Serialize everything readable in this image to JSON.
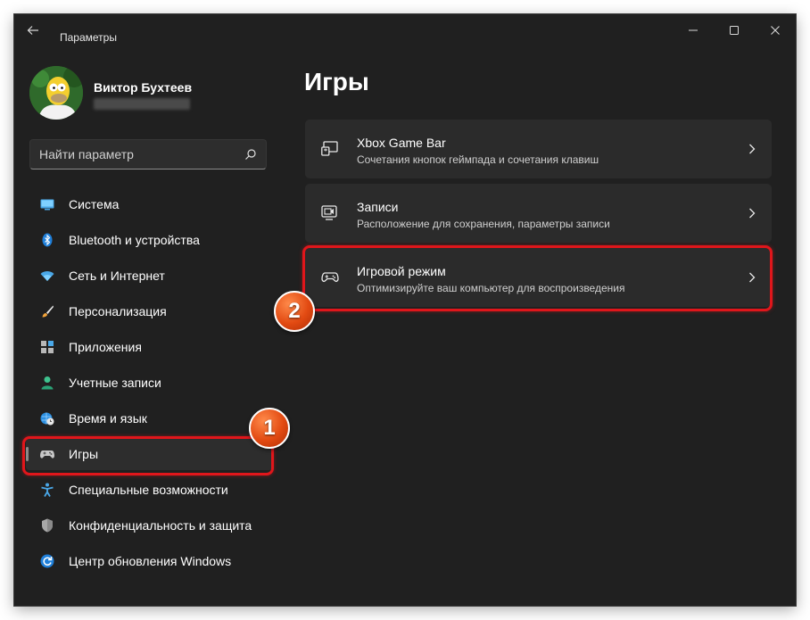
{
  "window": {
    "title": "Параметры",
    "controls": {
      "minimize": "minimize-icon",
      "maximize": "maximize-icon",
      "close": "close-icon"
    }
  },
  "user": {
    "name": "Виктор Бухтеев"
  },
  "search": {
    "placeholder": "Найти параметр",
    "value": ""
  },
  "sidebar": {
    "items": [
      {
        "label": "Система",
        "icon": "monitor-icon",
        "active": false
      },
      {
        "label": "Bluetooth и устройства",
        "icon": "bluetooth-icon",
        "active": false
      },
      {
        "label": "Сеть и Интернет",
        "icon": "wifi-icon",
        "active": false
      },
      {
        "label": "Персонализация",
        "icon": "brush-icon",
        "active": false
      },
      {
        "label": "Приложения",
        "icon": "apps-icon",
        "active": false
      },
      {
        "label": "Учетные записи",
        "icon": "person-icon",
        "active": false
      },
      {
        "label": "Время и язык",
        "icon": "globe-clock-icon",
        "active": false
      },
      {
        "label": "Игры",
        "icon": "gamepad-icon",
        "active": true
      },
      {
        "label": "Специальные возможности",
        "icon": "accessibility-icon",
        "active": false
      },
      {
        "label": "Конфиденциальность и защита",
        "icon": "shield-icon",
        "active": false
      },
      {
        "label": "Центр обновления Windows",
        "icon": "update-icon",
        "active": false
      }
    ]
  },
  "main": {
    "title": "Игры",
    "cards": [
      {
        "title": "Xbox Game Bar",
        "subtitle": "Сочетания кнопок геймпада и сочетания клавиш",
        "icon": "game-bar-icon"
      },
      {
        "title": "Записи",
        "subtitle": "Расположение для сохранения, параметры записи",
        "icon": "capture-icon"
      },
      {
        "title": "Игровой режим",
        "subtitle": "Оптимизируйте ваш компьютер для воспроизведения",
        "icon": "gamepad-icon"
      }
    ]
  },
  "annotations": {
    "step1": "1",
    "step2": "2",
    "color": "#e0161b"
  },
  "colors": {
    "background": "#202020",
    "card": "#2b2b2b",
    "accent": "#4cc2ff"
  }
}
